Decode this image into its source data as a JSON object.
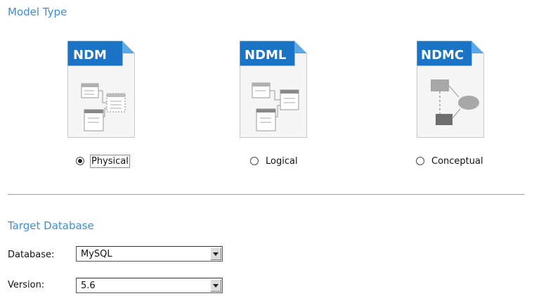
{
  "model_type": {
    "title": "Model Type",
    "options": [
      {
        "badge": "NDM",
        "label": "Physical",
        "checked": true,
        "icon": "physical-model-file-icon"
      },
      {
        "badge": "NDML",
        "label": "Logical",
        "checked": false,
        "icon": "logical-model-file-icon"
      },
      {
        "badge": "NDMC",
        "label": "Conceptual",
        "checked": false,
        "icon": "conceptual-model-file-icon"
      }
    ]
  },
  "target_database": {
    "title": "Target Database",
    "database_label": "Database:",
    "database_value": "MySQL",
    "version_label": "Version:",
    "version_value": "5.6"
  },
  "colors": {
    "accent": "#3a8fd6",
    "badge_blue": "#1a73c4",
    "fold": "#5aa9e6"
  }
}
